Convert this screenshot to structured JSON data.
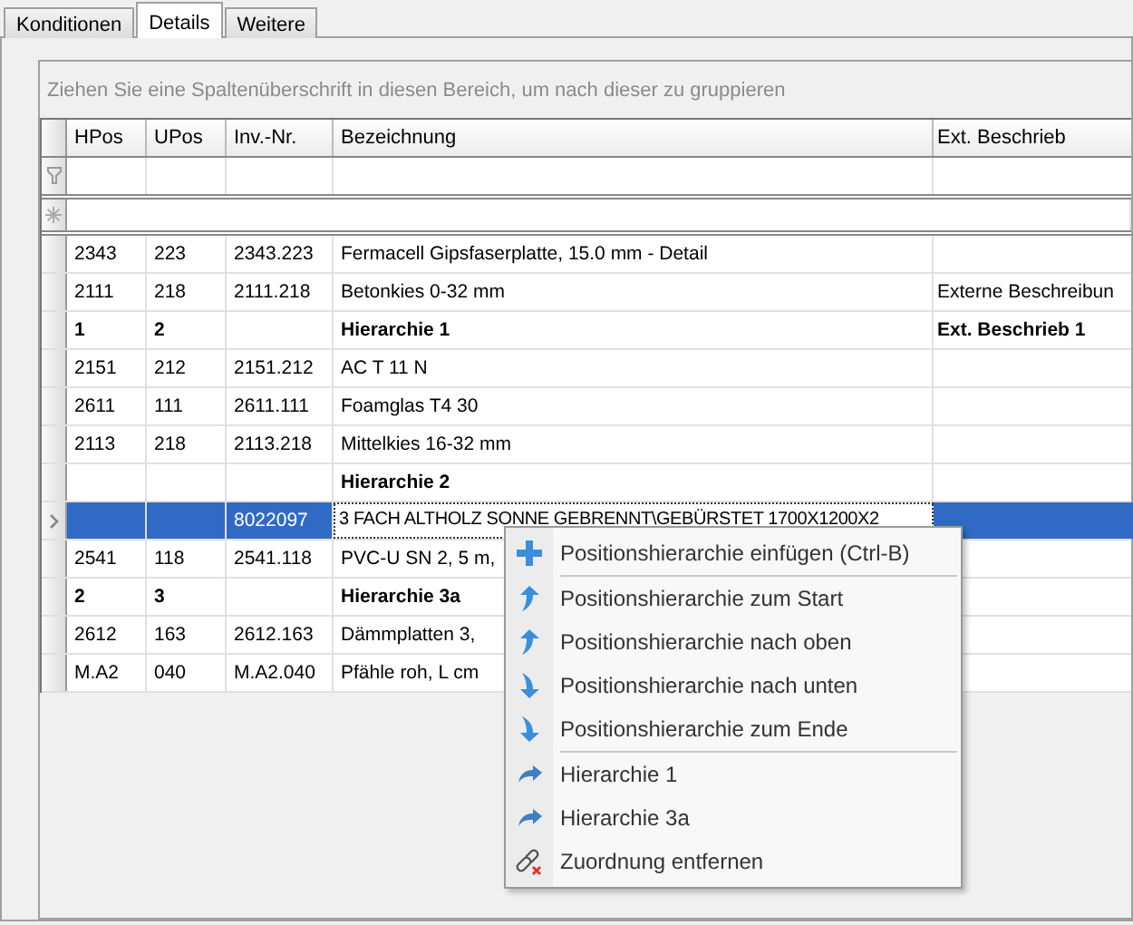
{
  "tabs": [
    {
      "label": "Konditionen",
      "selected": false
    },
    {
      "label": "Details",
      "selected": true
    },
    {
      "label": "Weitere",
      "selected": false
    }
  ],
  "group_panel": {
    "hint": "Ziehen Sie eine Spaltenüberschrift in diesen Bereich, um nach dieser zu gruppieren"
  },
  "table": {
    "columns": [
      "HPos",
      "UPos",
      "Inv.-Nr.",
      "Bezeichnung",
      "Ext. Beschrieb"
    ],
    "rows": [
      {
        "kind": "item",
        "selected": false,
        "cells": [
          "2343",
          "223",
          "2343.223",
          "Fermacell Gipsfaserplatte, 15.0 mm - Detail",
          ""
        ]
      },
      {
        "kind": "item",
        "selected": false,
        "cells": [
          "2111",
          "218",
          "2111.218",
          "Betonkies 0-32 mm",
          "Externe Beschreibun"
        ]
      },
      {
        "kind": "group",
        "selected": false,
        "cells": [
          "1",
          "2",
          "",
          "Hierarchie 1",
          "Ext. Beschrieb 1"
        ]
      },
      {
        "kind": "item",
        "selected": false,
        "cells": [
          "2151",
          "212",
          "2151.212",
          "AC T 11 N",
          ""
        ]
      },
      {
        "kind": "item",
        "selected": false,
        "cells": [
          "2611",
          "111",
          "2611.111",
          "Foamglas  T4   30",
          ""
        ]
      },
      {
        "kind": "item",
        "selected": false,
        "cells": [
          "2113",
          "218",
          "2113.218",
          "Mittelkies 16-32 mm",
          ""
        ]
      },
      {
        "kind": "group",
        "selected": false,
        "cells": [
          "",
          "",
          "",
          "Hierarchie 2",
          ""
        ]
      },
      {
        "kind": "item",
        "selected": true,
        "cells": [
          "",
          "",
          "8022097",
          " 3 FACH ALTHOLZ SONNE GEBRENNT\\GEBÜRSTET 1700X1200X2",
          ""
        ]
      },
      {
        "kind": "item",
        "selected": false,
        "cells": [
          "2541",
          "118",
          "2541.118",
          "PVC-U SN 2, 5 m,",
          ""
        ]
      },
      {
        "kind": "group",
        "selected": false,
        "cells": [
          "2",
          "3",
          "",
          "Hierarchie 3a",
          ""
        ]
      },
      {
        "kind": "item",
        "selected": false,
        "cells": [
          "2612",
          "163",
          "2612.163",
          "Dämmplatten 3,",
          ""
        ]
      },
      {
        "kind": "item",
        "selected": false,
        "cells": [
          "M.A2",
          "040",
          "M.A2.040",
          "Pfähle roh, L cm",
          ""
        ]
      }
    ]
  },
  "context_menu": [
    {
      "kind": "insert",
      "label": "Positionshierarchie einfügen (Ctrl-B)",
      "separator_before": false
    },
    {
      "kind": "up",
      "label": "Positionshierarchie zum Start",
      "separator_before": true
    },
    {
      "kind": "up",
      "label": "Positionshierarchie nach oben",
      "separator_before": false
    },
    {
      "kind": "down",
      "label": "Positionshierarchie nach unten",
      "separator_before": false
    },
    {
      "kind": "down",
      "label": "Positionshierarchie zum Ende",
      "separator_before": false
    },
    {
      "kind": "goto",
      "label": "Hierarchie 1",
      "separator_before": true
    },
    {
      "kind": "goto",
      "label": "Hierarchie 3a",
      "separator_before": false
    },
    {
      "kind": "unlink",
      "label": "Zuordnung entfernen",
      "separator_before": false
    }
  ]
}
